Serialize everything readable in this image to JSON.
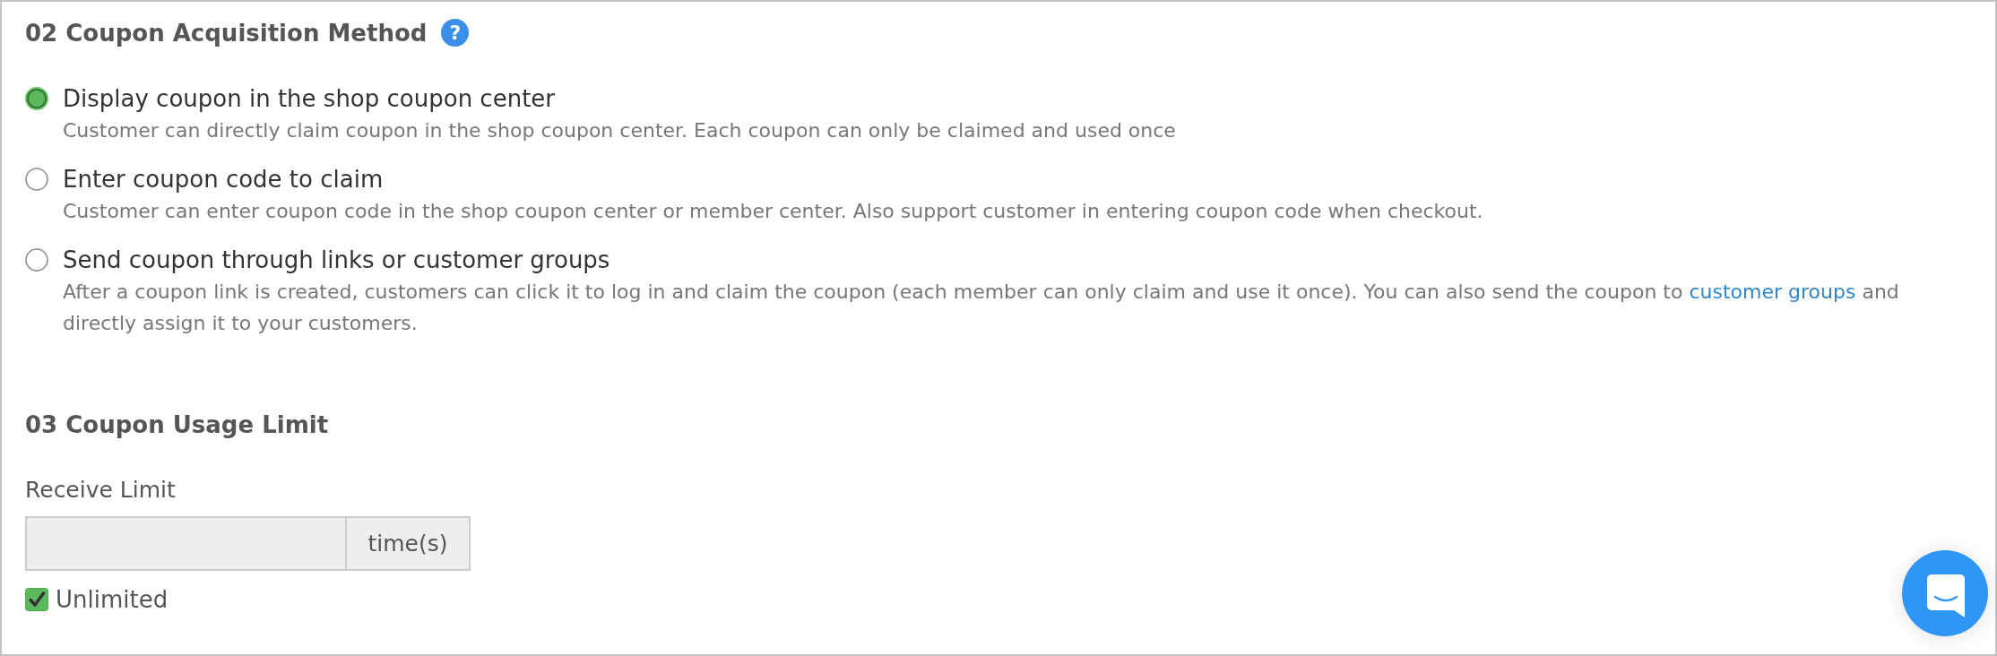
{
  "acquisition": {
    "title": "02 Coupon Acquisition Method",
    "help": "?",
    "options": [
      {
        "label": "Display coupon in the shop coupon center",
        "selected": true,
        "description": [
          {
            "kind": "text",
            "text": "Customer can directly claim coupon in the shop coupon center. Each coupon can only be claimed and used once"
          }
        ]
      },
      {
        "label": "Enter coupon code to claim",
        "selected": false,
        "description": [
          {
            "kind": "text",
            "text": "Customer can enter coupon code in the shop coupon center or member center. Also support customer in entering coupon code when checkout."
          }
        ]
      },
      {
        "label": "Send coupon through links or customer groups",
        "selected": false,
        "description": [
          {
            "kind": "text",
            "text": "After a coupon link is created, customers can click it to log in and claim the coupon (each member can only claim and use it once). You can also send the coupon to "
          },
          {
            "kind": "link",
            "text": "customer groups"
          },
          {
            "kind": "text",
            "text": " and directly assign it to your customers."
          }
        ]
      }
    ]
  },
  "usage_limit": {
    "title": "03 Coupon Usage Limit",
    "field": {
      "label": "Receive Limit",
      "unit": "time(s)",
      "disabled": true
    },
    "unlimited": {
      "label": "Unlimited",
      "checked": true
    }
  }
}
